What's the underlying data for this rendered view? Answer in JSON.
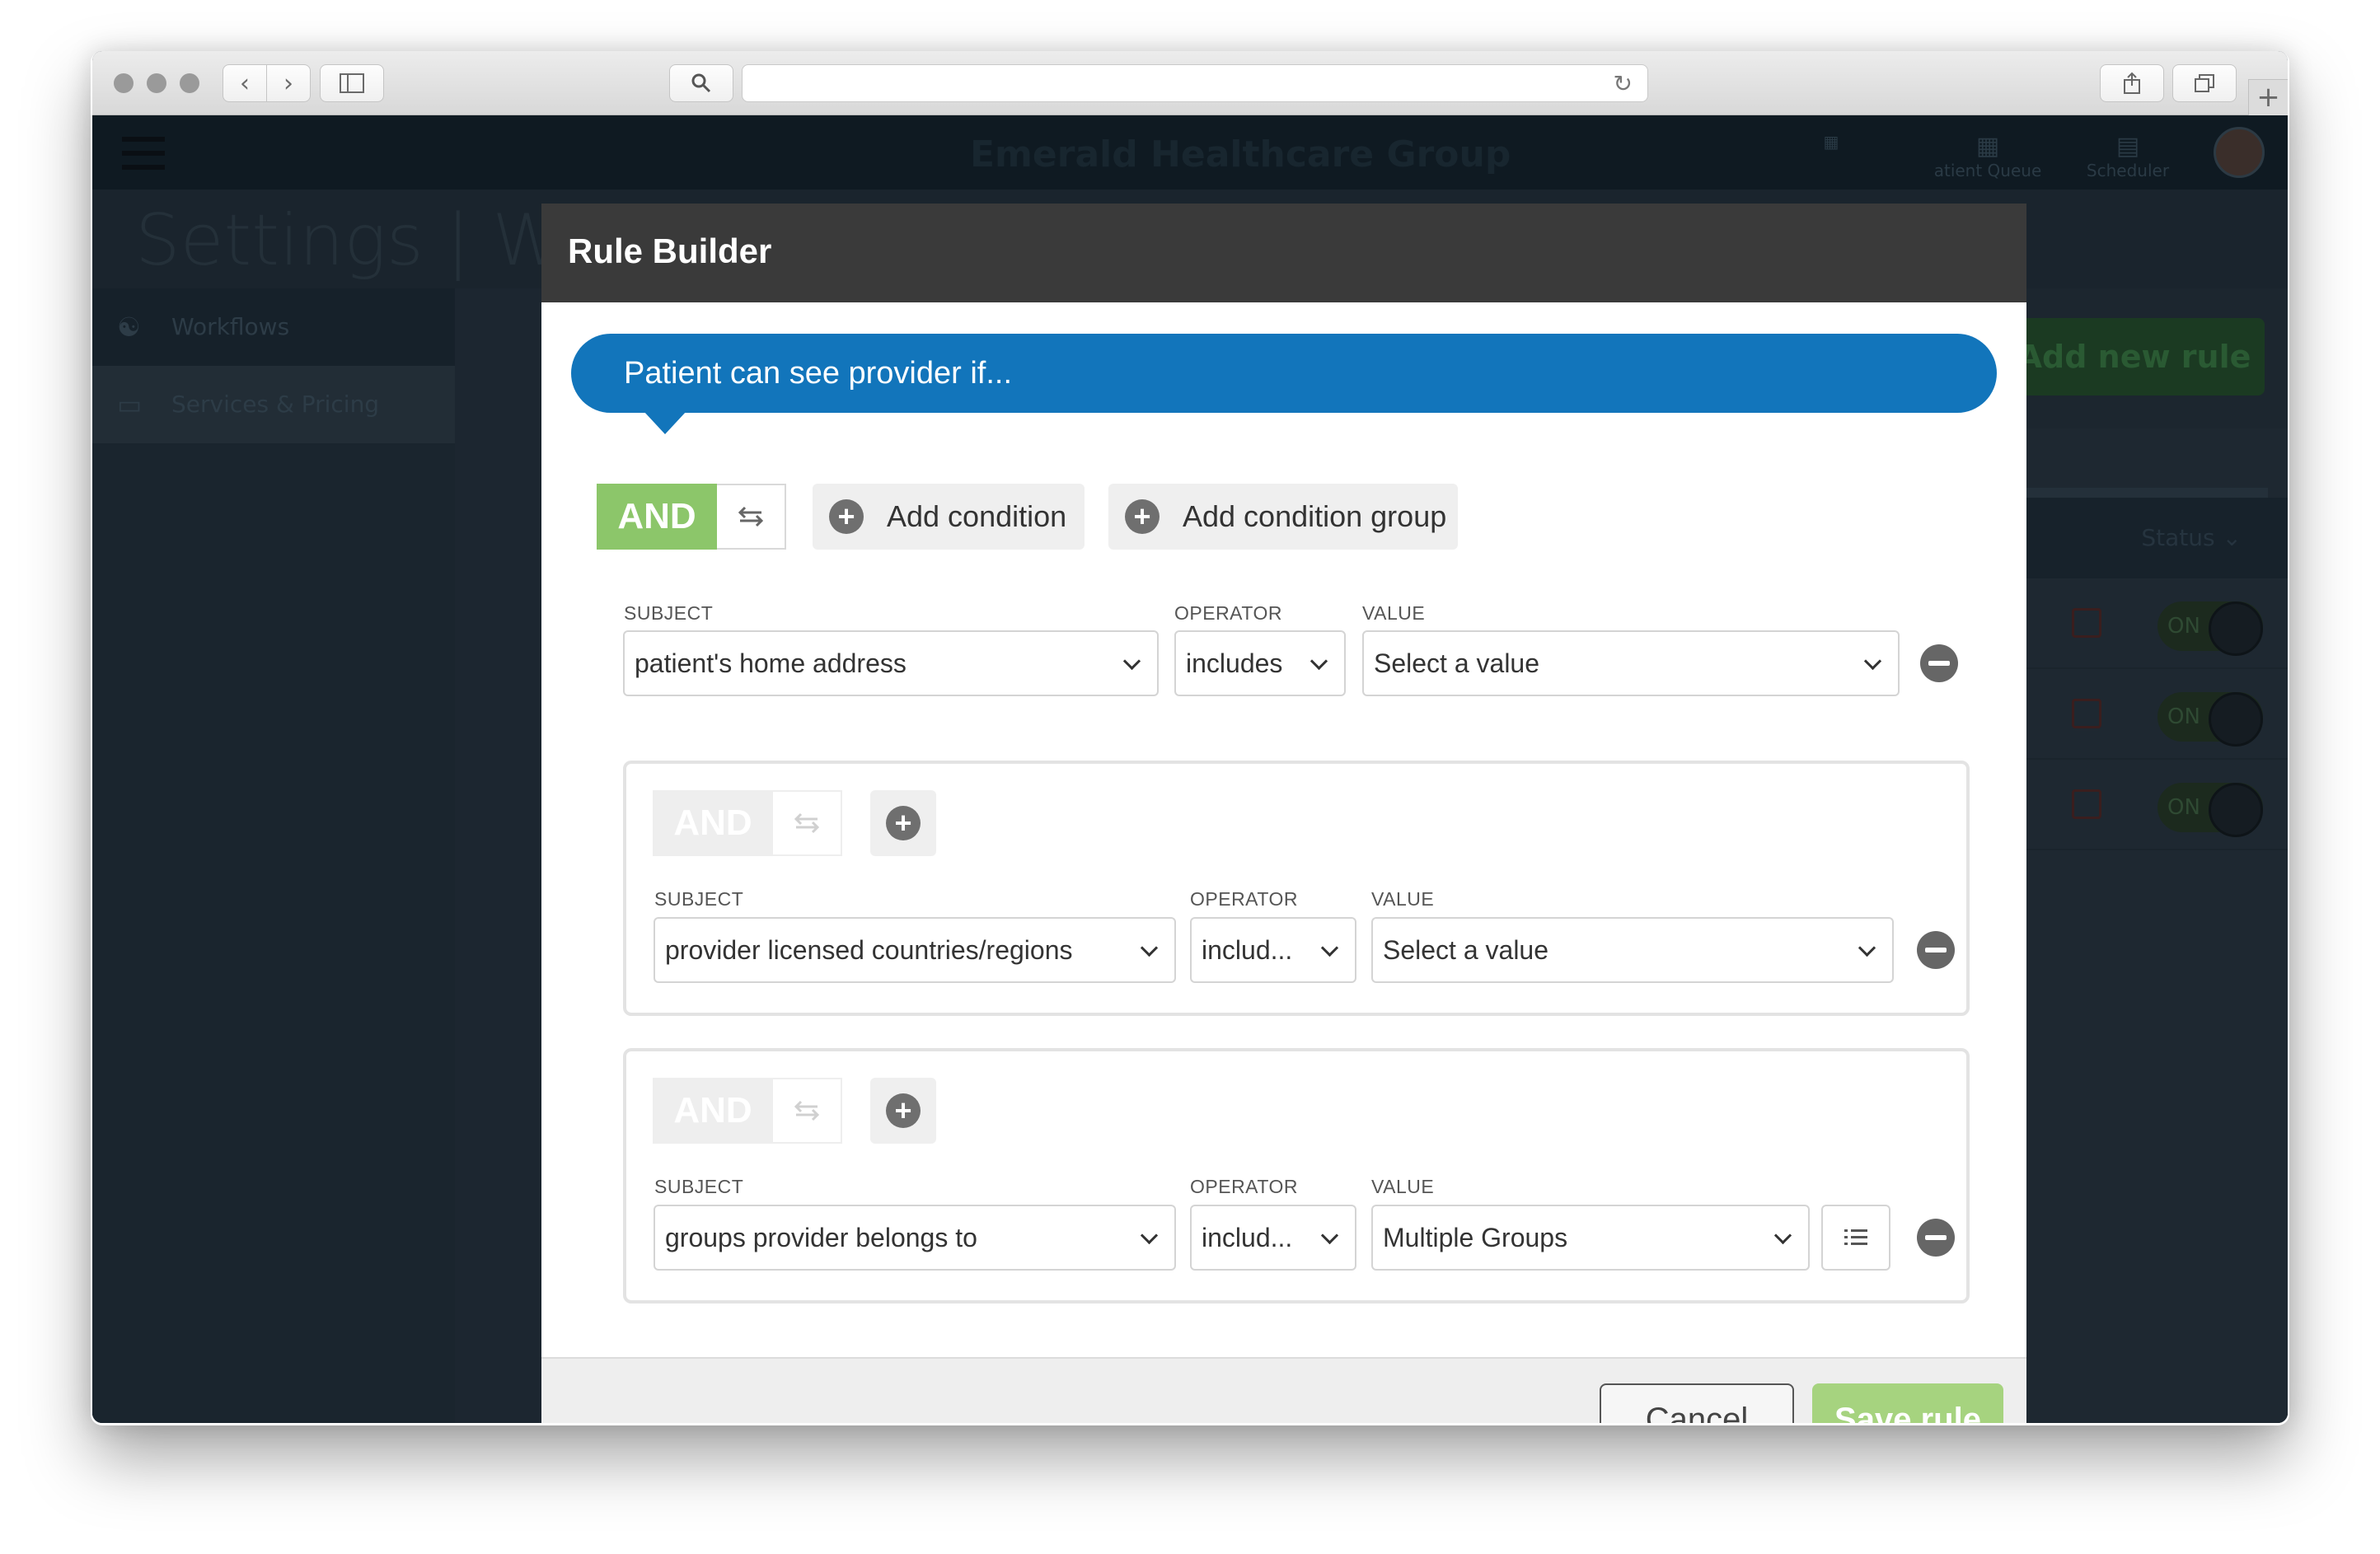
{
  "browser": {
    "back_icon": "chevron-left-icon",
    "forward_icon": "chevron-right-icon",
    "sidebar_icon": "sidebar-icon",
    "search_icon": "search-icon",
    "reload_icon": "reload-icon",
    "share_icon": "share-icon",
    "tabs_icon": "tabs-icon",
    "newtab_label": "+"
  },
  "app": {
    "brand": "Emerald Healthcare Group",
    "nav": [
      {
        "label": "",
        "icon": "grid-icon"
      },
      {
        "label": "atient Queue",
        "icon": "queue-icon"
      },
      {
        "label": "Scheduler",
        "icon": "calendar-icon"
      }
    ],
    "settings_title": "Settings | W",
    "sidebar": [
      {
        "label": "Workflows",
        "icon": "workflow-icon"
      },
      {
        "label": "Services & Pricing",
        "icon": "card-icon"
      }
    ],
    "add_rule_label": "Add new rule",
    "status_header": "Status",
    "rows": [
      {
        "toggle": "ON"
      },
      {
        "toggle": "ON"
      },
      {
        "toggle": "ON"
      }
    ]
  },
  "modal": {
    "title": "Rule Builder",
    "banner": "Patient can see provider if...",
    "root": {
      "and_label": "AND",
      "add_condition": "Add condition",
      "add_condition_group": "Add condition group",
      "condition": {
        "subject_label": "SUBJECT",
        "subject_value": "patient's home address",
        "operator_label": "OPERATOR",
        "operator_value": "includes",
        "value_label": "VALUE",
        "value_value": "Select a value"
      }
    },
    "groups": [
      {
        "and_label": "AND",
        "subject_label": "SUBJECT",
        "subject_value": "provider licensed countries/regions",
        "operator_label": "OPERATOR",
        "operator_value": "includ...",
        "value_label": "VALUE",
        "value_value": "Select a value"
      },
      {
        "and_label": "AND",
        "subject_label": "SUBJECT",
        "subject_value": "groups provider belongs to",
        "operator_label": "OPERATOR",
        "operator_value": "includ...",
        "value_label": "VALUE",
        "value_value": "Multiple Groups"
      }
    ],
    "cancel_label": "Cancel",
    "save_label": "Save rule"
  },
  "colors": {
    "banner": "#1275bb",
    "and_active": "#8cc66a",
    "and_inactive": "#eeeeee",
    "save": "#a6d37f",
    "modal_header": "#3a3a3a"
  }
}
